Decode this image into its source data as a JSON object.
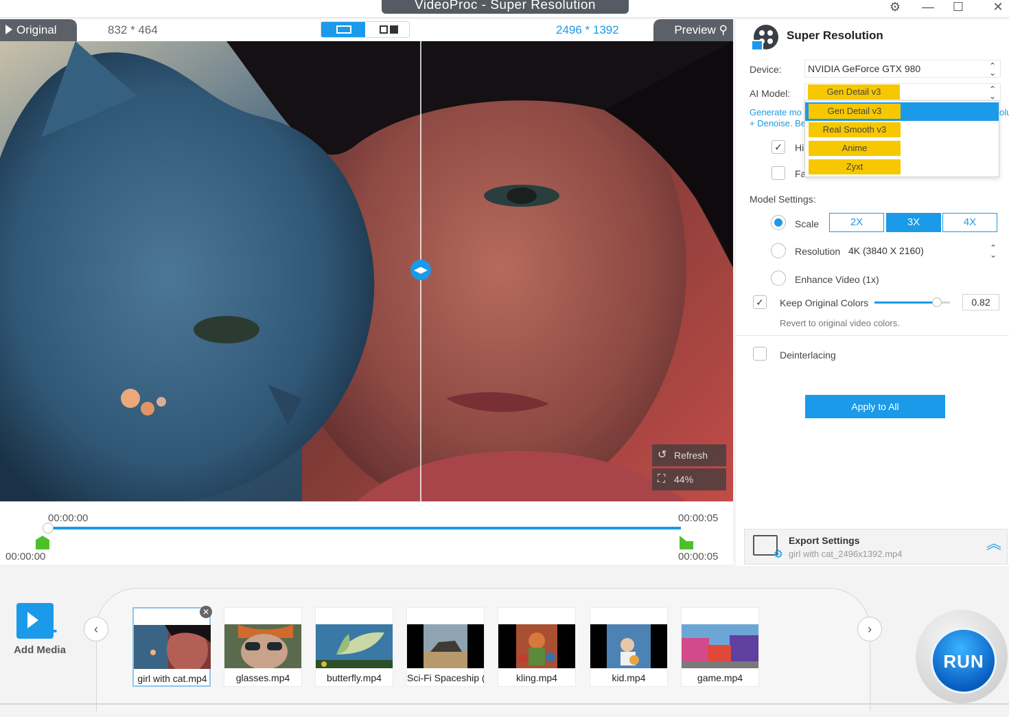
{
  "window": {
    "title": "VideoProc  -  Super Resolution",
    "settings_icon": "gear-icon",
    "minimize_icon": "minimize-icon",
    "maximize_icon": "maximize-icon",
    "close_icon": "close-icon"
  },
  "preview": {
    "original_tab": "Original",
    "original_resolution": "832 * 464",
    "output_resolution": "2496 * 1392",
    "preview_tab": "Preview",
    "refresh_label": "Refresh",
    "zoom_label": "44%",
    "split_position": 0.57
  },
  "timeline": {
    "start_top": "00:00:00",
    "end_top": "00:00:05",
    "start_bottom": "00:00:00",
    "end_bottom": "00:00:05"
  },
  "panel": {
    "title": "Super Resolution",
    "device_label": "Device:",
    "device_value": "NVIDIA GeForce GTX 980",
    "ai_model_label": "AI Model:",
    "ai_model_value": "Gen Detail v3",
    "ai_model_options": [
      "Gen Detail v3",
      "Real Smooth v3",
      "Anime",
      "Zyxt"
    ],
    "note_line1_left": "Generate mo",
    "note_line1_right": "olu",
    "note_line2": "+ Denoise. Be",
    "check1_label": "Hi",
    "check2_label": "Fa",
    "model_settings_label": "Model Settings:",
    "scale_label": "Scale",
    "scale_options": [
      "2X",
      "3X",
      "4X"
    ],
    "scale_selected": "3X",
    "resolution_label": "Resolution",
    "resolution_value": "4K (3840 X 2160)",
    "enhance_label": "Enhance Video (1x)",
    "keep_colors_label": "Keep Original Colors",
    "keep_colors_value": "0.82",
    "keep_colors_hint": "Revert to original video colors.",
    "deinterlacing_label": "Deinterlacing",
    "apply_all_label": "Apply to All"
  },
  "export": {
    "title": "Export Settings",
    "filename": "girl with cat_2496x1392.mp4"
  },
  "media": {
    "add_label": "Add Media",
    "items": [
      {
        "name": "girl with cat.mp4"
      },
      {
        "name": "glasses.mp4"
      },
      {
        "name": "butterfly.mp4"
      },
      {
        "name": "Sci-Fi Spaceship (",
        "truncated": true
      },
      {
        "name": "kling.mp4"
      },
      {
        "name": "kid.mp4"
      },
      {
        "name": "game.mp4"
      }
    ],
    "run_label": "RUN"
  },
  "colors": {
    "accent": "#1a9ae8",
    "chip": "#f7c800",
    "tab_dark": "#5c6168"
  }
}
